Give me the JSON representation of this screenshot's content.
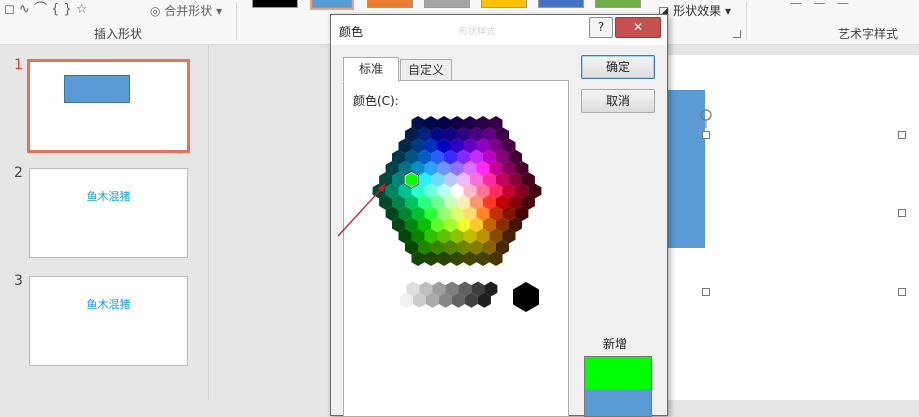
{
  "ribbon": {
    "insert_shapes_label": "插入形状",
    "merge_shapes_label": "合并形状",
    "shape_effects_label": "形状效果",
    "wordart_styles_label": "艺术字样式",
    "swatches": [
      "#000000",
      "#5b9bd5",
      "#ed7d31",
      "#a5a5a5",
      "#ffc000",
      "#4472c4",
      "#70ad47"
    ]
  },
  "slides": [
    {
      "number": "1",
      "caption": ""
    },
    {
      "number": "2",
      "caption": "鱼木混猪"
    },
    {
      "number": "3",
      "caption": "鱼木混猪"
    }
  ],
  "shape_color": "#5b9bd5",
  "dialog": {
    "title": "颜色",
    "faint_title": "形状样式",
    "help_label": "?",
    "close_label": "✕",
    "tabs": [
      "标准",
      "自定义"
    ],
    "colors_label": "颜色(C):",
    "ok_label": "确定",
    "cancel_label": "取消",
    "new_label": "新增",
    "new_color": "#00ff00",
    "current_color": "#5b9bd5",
    "selected_color": "#00ff00"
  }
}
